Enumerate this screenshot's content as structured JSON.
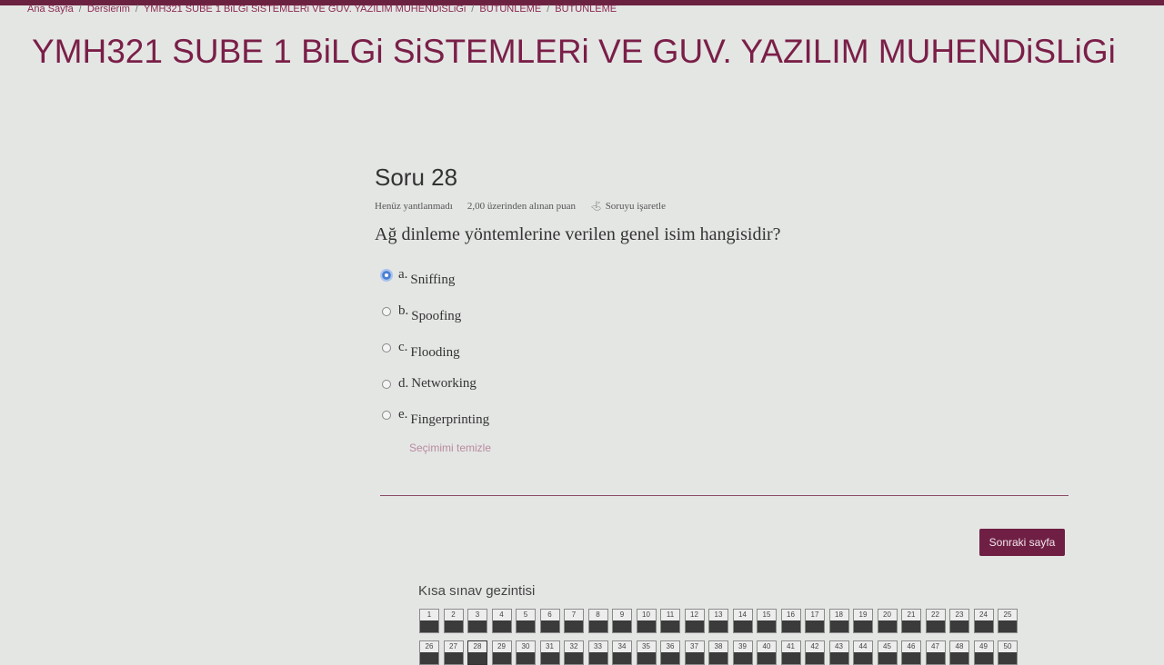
{
  "breadcrumb": {
    "items": [
      "Ana Sayfa",
      "Derslerim",
      "YMH321 SUBE 1 BiLGi SiSTEMLERi VE GUV. YAZILIM MUHENDiSLiGi",
      "BÜTÜNLEME",
      "BÜTÜNLEME"
    ]
  },
  "course_title": "YMH321 SUBE 1 BiLGi SiSTEMLERi VE GUV. YAZILIM MUHENDiSLiGi",
  "question": {
    "heading": "Soru 28",
    "status": "Henüz yantlanmadı",
    "points": "2,00 üzerinden alınan puan",
    "flag_label": "Soruyu işaretle",
    "text": "Ağ dinleme yöntemlerine verilen genel isim hangisidir?",
    "options": [
      {
        "letter": "a.",
        "text": "Sniffing",
        "selected": true
      },
      {
        "letter": "b.",
        "text": "Spoofing",
        "selected": false
      },
      {
        "letter": "c.",
        "text": "Flooding",
        "selected": false
      },
      {
        "letter": "d.",
        "text": "Networking",
        "selected": false
      },
      {
        "letter": "e.",
        "text": "Fingerprinting",
        "selected": false
      }
    ],
    "clear_label": "Seçimimi temizle"
  },
  "next_button": "Sonraki sayfa",
  "quiz_nav": {
    "title": "Kısa sınav gezintisi",
    "numbers": [
      "1",
      "2",
      "3",
      "4",
      "5",
      "6",
      "7",
      "8",
      "9",
      "10",
      "11",
      "12",
      "13",
      "14",
      "15",
      "16",
      "17",
      "18",
      "19",
      "20",
      "21",
      "22",
      "23",
      "24",
      "25",
      "26",
      "27",
      "28",
      "29",
      "30",
      "31",
      "32",
      "33",
      "34",
      "35",
      "36",
      "37",
      "38",
      "39",
      "40",
      "41",
      "42",
      "43",
      "44",
      "45",
      "46",
      "47",
      "48",
      "49",
      "50"
    ],
    "current": "28"
  },
  "colors": {
    "brand": "#7a1f48",
    "button_bg": "#6f1f44",
    "selected_radio": "#4a7fd4"
  }
}
